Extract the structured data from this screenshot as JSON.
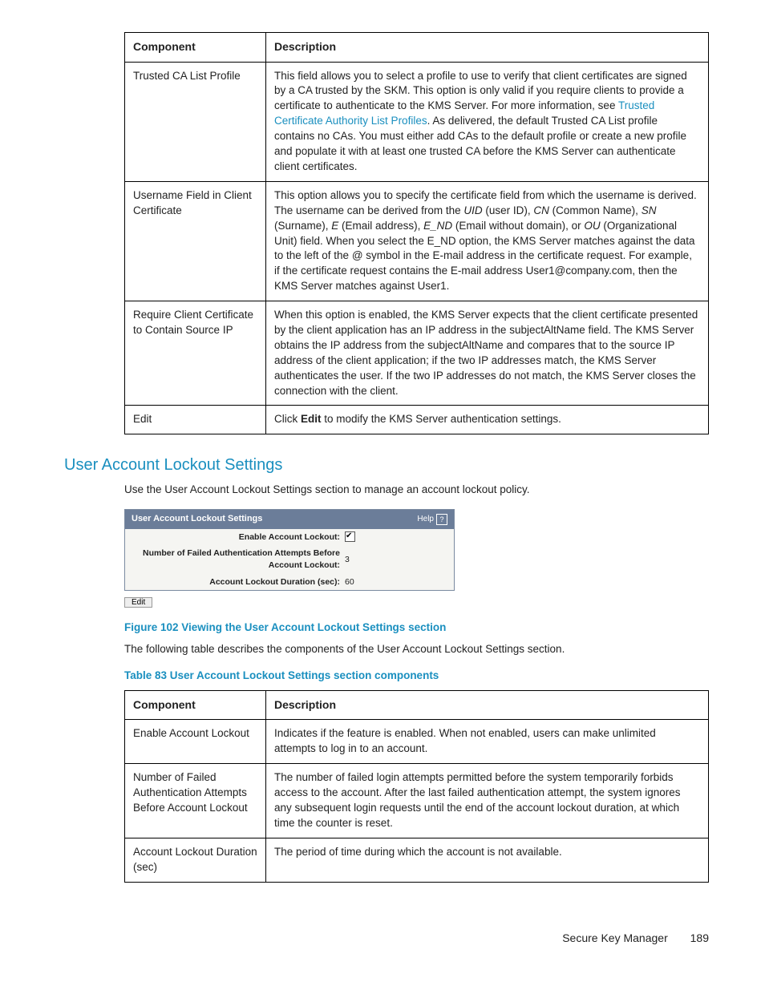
{
  "table1": {
    "headers": [
      "Component",
      "Description"
    ],
    "rows": [
      {
        "component": "Trusted CA List Profile",
        "desc_pre": "This field allows you to select a profile to use to verify that client certificates are signed by a CA trusted by the SKM. This option is only valid if you require clients to provide a certificate to authenticate to the KMS Server. For more information, see ",
        "link": "Trusted Certificate Authority List Profiles",
        "desc_post": ". As delivered, the default Trusted CA List profile contains no CAs. You must either add CAs to the default profile or create a new profile and populate it with at least one trusted CA before the KMS Server can authenticate client certificates."
      },
      {
        "component": "Username Field in Client Certificate",
        "part1": "This option allows you to specify the certificate field from which the username is derived. The username can be derived from the ",
        "i1": "UID",
        "t1": " (user ID), ",
        "i2": "CN",
        "t2": " (Common Name), ",
        "i3": "SN",
        "t3": " (Surname), ",
        "i4": "E",
        "t4": " (Email address), ",
        "i5": "E_ND",
        "t5": " (Email without domain), or ",
        "i6": "OU",
        "part2": " (Organizational Unit) field. When you select the E_ND option, the KMS Server matches against the data to the left of the @ symbol in the E-mail address in the certificate request. For example, if the certificate request contains the E-mail address User1@company.com, then the KMS Server matches against User1."
      },
      {
        "component": "Require Client Certificate to Contain Source IP",
        "desc": "When this option is enabled, the KMS Server expects that the client certificate presented by the client application has an IP address in the subjectAltName field. The KMS Server obtains the IP address from the subjectAltName and compares that to the source IP address of the client application; if the two IP addresses match, the KMS Server authenticates the user. If the two IP addresses do not match, the KMS Server closes the connection with the client."
      },
      {
        "component": "Edit",
        "pre": "Click ",
        "bold": "Edit",
        "post": " to modify the KMS Server authentication settings."
      }
    ]
  },
  "section_heading": "User Account Lockout Settings",
  "intro_paragraph": "Use the User Account Lockout Settings section to manage an account lockout policy.",
  "screenshot": {
    "title": "User Account Lockout Settings",
    "help": "Help",
    "rows": [
      {
        "label": "Enable Account Lockout:",
        "type": "checkbox"
      },
      {
        "label": "Number of Failed Authentication Attempts Before Account Lockout:",
        "value": "3"
      },
      {
        "label": "Account Lockout Duration (sec):",
        "value": "60"
      }
    ],
    "edit_label": "Edit"
  },
  "figure_caption": "Figure 102 Viewing the User Account Lockout Settings section",
  "table2_intro": "The following table describes the components of the User Account Lockout Settings section.",
  "table2_caption": "Table 83 User Account Lockout Settings section components",
  "table2": {
    "headers": [
      "Component",
      "Description"
    ],
    "rows": [
      {
        "component": "Enable Account Lockout",
        "desc": "Indicates if the feature is enabled. When not enabled, users can make unlimited attempts to log in to an account."
      },
      {
        "component": "Number of Failed Authentication Attempts Before Account Lockout",
        "desc": "The number of failed login attempts permitted before the system temporarily forbids access to the account. After the last failed authentication attempt, the system ignores any subsequent login requests until the end of the account lockout duration, at which time the counter is reset."
      },
      {
        "component": "Account Lockout Duration (sec)",
        "desc": "The period of time during which the account is not available."
      }
    ]
  },
  "footer": {
    "title": "Secure Key Manager",
    "page": "189"
  }
}
